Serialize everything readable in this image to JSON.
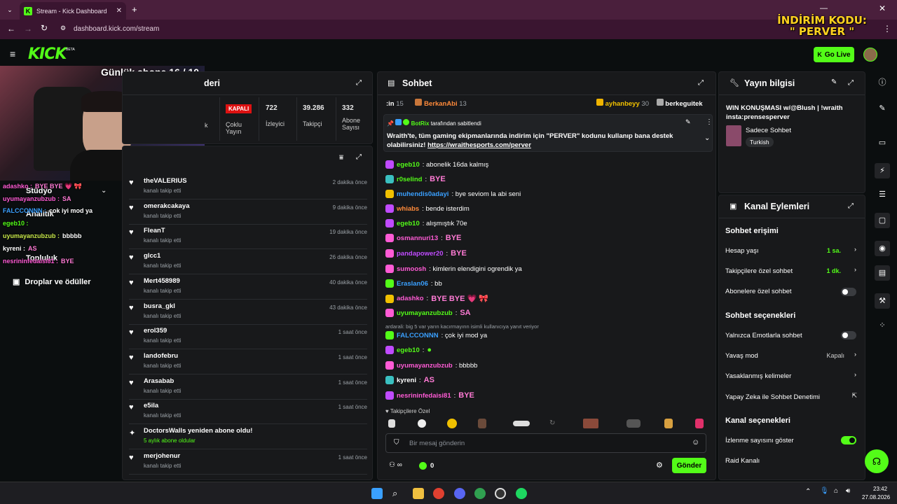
{
  "browser": {
    "tab_title": "Stream - Kick Dashboard",
    "url": "dashboard.kick.com/stream",
    "promo_line1": "İNDİRİM KODU:",
    "promo_line2": "\" PERVER \""
  },
  "header": {
    "logo": "KICK",
    "beta": "BETA",
    "go_live": "Go Live"
  },
  "overlay": {
    "sub_goal": "Günlük abone 16 / 10"
  },
  "left_nav": {
    "items": [
      "Stüdyo",
      "Analitik",
      "Topluluk",
      "Droplar ve ödüller"
    ]
  },
  "overlay_chat": [
    {
      "user": "adashko :",
      "msg": "BYE BYE 💗 🎀",
      "color": "#ff5bd5"
    },
    {
      "user": "uyumayanzubzub :",
      "msg": "SA",
      "color": "#ff5bd5"
    },
    {
      "user": "FALCCONNN :",
      "msg": "çok iyi mod ya",
      "color": "#3aa0ff"
    },
    {
      "user": "egeb10 :",
      "msg": "",
      "color": "#53fc18"
    },
    {
      "user": "uyumayanzubzub :",
      "msg": "bbbbb",
      "color": "#c8e94a"
    },
    {
      "user": "kyreni :",
      "msg": "AS",
      "color": "#ffffff"
    },
    {
      "user": "nesrininfedaisi81 :",
      "msg": "BYE",
      "color": "#ff5bd5"
    }
  ],
  "stats": {
    "title_partial": "deri",
    "closed_badge": "KAPALI",
    "closed_label_1": "Çoklu",
    "closed_label_2": "Yayın",
    "partial": "k",
    "viewers": "722",
    "viewers_label": "İzleyici",
    "followers": "39.286",
    "followers_label": "Takipçi",
    "subs": "332",
    "subs_label_1": "Abone",
    "subs_label_2": "Sayısı"
  },
  "activity": [
    {
      "name": "theVALERIUS",
      "sub": "kanalı takip etti",
      "time": "2 dakika önce"
    },
    {
      "name": "omerakcakaya",
      "sub": "kanalı takip etti",
      "time": "9 dakika önce"
    },
    {
      "name": "FleanT",
      "sub": "kanalı takip etti",
      "time": "19 dakika önce"
    },
    {
      "name": "glcc1",
      "sub": "kanalı takip etti",
      "time": "26 dakika önce"
    },
    {
      "name": "Mert458989",
      "sub": "kanalı takip etti",
      "time": "40 dakika önce"
    },
    {
      "name": "busra_gkl",
      "sub": "kanalı takip etti",
      "time": "43 dakika önce"
    },
    {
      "name": "erol359",
      "sub": "kanalı takip etti",
      "time": "1 saat önce"
    },
    {
      "name": "landofebru",
      "sub": "kanalı takip etti",
      "time": "1 saat önce"
    },
    {
      "name": "Arasabab",
      "sub": "kanalı takip etti",
      "time": "1 saat önce"
    },
    {
      "name": "e5ila",
      "sub": "kanalı takip etti",
      "time": "1 saat önce"
    },
    {
      "name": "DoctorsWalls yeniden abone oldu!",
      "sub": "5 aylık abone oldular",
      "time": ""
    },
    {
      "name": "merjohenur",
      "sub": "kanalı takip etti",
      "time": "1 saat önce"
    }
  ],
  "chat": {
    "title": "Sohbet",
    "top": {
      "a": ":in",
      "a_n": "15",
      "b": "BerkanAbi",
      "b_n": "13",
      "c": "ayhanbeyy",
      "c_n": "30",
      "d": "berkeguitek"
    },
    "pinned_by": "BotRix",
    "pinned_suffix": "tarafından sabitlendi",
    "pinned_text": "Wraith'te, tüm gaming ekipmanlarında indirim için \"PERVER\" kodunu kullanıp bana destek olabilirsiniz!",
    "pinned_link": "https://wraithesports.com/perver",
    "messages": [
      {
        "user": "egeb10",
        "color": "#53fc18",
        "text": ": abonelik 16da kalmış"
      },
      {
        "user": "r0selind",
        "color": "#53fc18",
        "text": ":",
        "emote": "BYE"
      },
      {
        "user": "muhendis0adayi",
        "color": "#3aa0ff",
        "text": ": bye seviom la abi seni"
      },
      {
        "user": "whiabs",
        "color": "#ff8a3a",
        "text": ": bende isterdim"
      },
      {
        "user": "egeb10",
        "color": "#53fc18",
        "text": ": alışmıştık 70e"
      },
      {
        "user": "osmannuri13",
        "color": "#ff5bd5",
        "text": ":",
        "emote": "BYE"
      },
      {
        "user": "pandapower20",
        "color": "#c04bff",
        "text": ":",
        "emote": "BYE"
      },
      {
        "user": "sumoosh",
        "color": "#ff5bd5",
        "text": ": kimlerin elendigini ogrendik ya"
      },
      {
        "user": "Eraslan06",
        "color": "#3aa0ff",
        "text": ": bb"
      },
      {
        "user": "adashko",
        "color": "#ff5bd5",
        "text": ":",
        "emote": "BYE BYE 💗 🎀"
      },
      {
        "user": "uyumayanzubzub",
        "color": "#53fc18",
        "text": ":",
        "emote": "SA"
      },
      {
        "user": "FALCCONNN",
        "color": "#3aa0ff",
        "text": ": çok iyi mod ya"
      },
      {
        "user": "egeb10",
        "color": "#53fc18",
        "text": ":",
        "emote": "●"
      },
      {
        "user": "uyumayanzubzub",
        "color": "#ff5bd5",
        "text": ": bbbbb"
      },
      {
        "user": "kyreni",
        "color": "#ffffff",
        "text": ":",
        "emote": "AS"
      },
      {
        "user": "nesrininfedaisi81",
        "color": "#ff5bd5",
        "text": ":",
        "emote": "BYE"
      }
    ],
    "reply_hint": "ardarali: big 5 var yarın kacırmayınn isimli kullanıcıya yanıt veriyor",
    "followers_only": "Takipçilere Özel",
    "input_placeholder": "Bir mesaj gönderin",
    "zero": "0",
    "send": "Gönder"
  },
  "stream_info": {
    "title": "Yayın bilgisi",
    "stream_title": "WIN KONUŞMASI w/@Blush | !wraith insta:prensesperver",
    "category": "Sadece Sohbet",
    "tag": "Turkish"
  },
  "channel_actions": {
    "title": "Kanal Eylemleri",
    "chat_access": "Sohbet erişimi",
    "account_age": "Hesap yaşı",
    "account_age_v": "1 sa.",
    "followers_chat": "Takipçilere özel sohbet",
    "followers_chat_v": "1 dk.",
    "subs_chat": "Abonelere özel sohbet",
    "chat_options": "Sohbet seçenekleri",
    "emote_only": "Yalnızca Emotlarla sohbet",
    "slow_mode": "Yavaş mod",
    "slow_mode_v": "Kapalı",
    "banned_words": "Yasaklanmış kelimeler",
    "ai_mod": "Yapay Zeka ile Sohbet Denetimi",
    "channel_options": "Kanal seçenekleri",
    "show_viewers": "İzlenme sayısını göster",
    "raid": "Raid Kanalı"
  },
  "taskbar": {
    "time": "23:42",
    "date": "27.08.2026"
  }
}
